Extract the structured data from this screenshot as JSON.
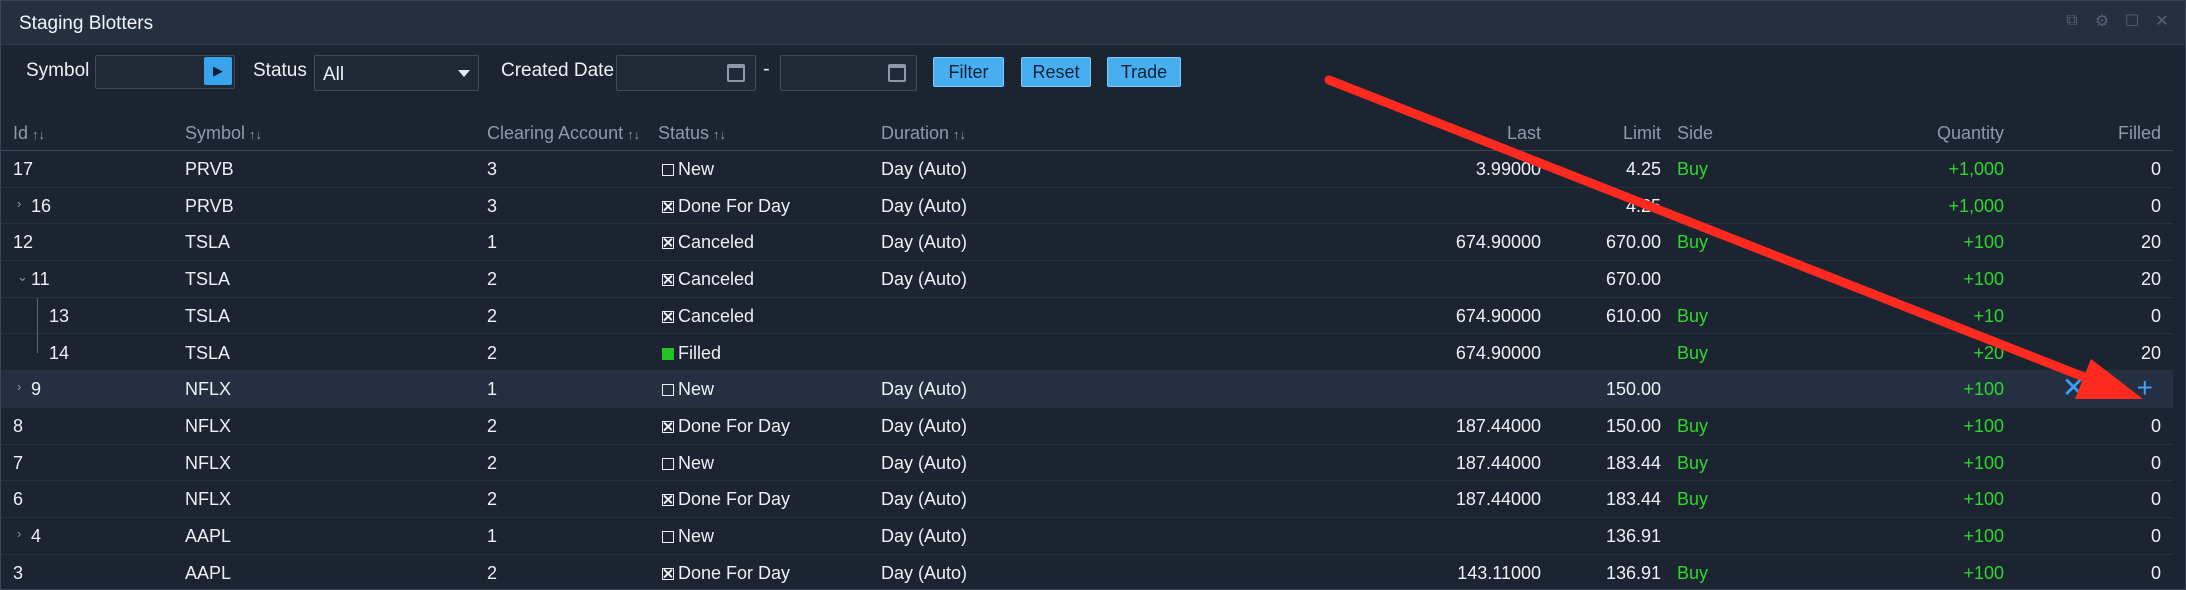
{
  "window": {
    "title": "Staging Blotters"
  },
  "toolbar": {
    "symbol_label": "Symbol",
    "symbol_value": "",
    "status_label": "Status",
    "status_value": "All",
    "created_date_label": "Created Date",
    "date_from": "",
    "date_to": "",
    "date_separator": "-",
    "filter_label": "Filter",
    "reset_label": "Reset",
    "trade_label": "Trade"
  },
  "columns": {
    "id": "Id",
    "symbol": "Symbol",
    "clearing_account": "Clearing Account",
    "status": "Status",
    "duration": "Duration",
    "last": "Last",
    "limit": "Limit",
    "side": "Side",
    "quantity": "Quantity",
    "filled": "Filled"
  },
  "rows": [
    {
      "id": "17",
      "symbol": "PRVB",
      "account": "3",
      "status": "New",
      "status_icon": "empty-square",
      "duration": "Day (Auto)",
      "last": "3.99000",
      "limit": "4.25",
      "side": "Buy",
      "quantity": "+1,000",
      "filled": "0"
    },
    {
      "id": "16",
      "symbol": "PRVB",
      "account": "3",
      "status": "Done For Day",
      "status_icon": "x-square",
      "duration": "Day (Auto)",
      "last": "",
      "limit": "4.25",
      "side": "",
      "quantity": "+1,000",
      "filled": "0"
    },
    {
      "id": "12",
      "symbol": "TSLA",
      "account": "1",
      "status": "Canceled",
      "status_icon": "x-square",
      "duration": "Day (Auto)",
      "last": "674.90000",
      "limit": "670.00",
      "side": "Buy",
      "quantity": "+100",
      "filled": "20"
    },
    {
      "id": "11",
      "symbol": "TSLA",
      "account": "2",
      "status": "Canceled",
      "status_icon": "x-square",
      "duration": "Day (Auto)",
      "last": "",
      "limit": "670.00",
      "side": "",
      "quantity": "+100",
      "filled": "20"
    },
    {
      "id": "13",
      "symbol": "TSLA",
      "account": "2",
      "status": "Canceled",
      "status_icon": "x-square",
      "duration": "",
      "last": "674.90000",
      "limit": "610.00",
      "side": "Buy",
      "quantity": "+10",
      "filled": "0"
    },
    {
      "id": "14",
      "symbol": "TSLA",
      "account": "2",
      "status": "Filled",
      "status_icon": "filled-square",
      "duration": "",
      "last": "674.90000",
      "limit": "",
      "side": "Buy",
      "quantity": "+20",
      "filled": "20"
    },
    {
      "id": "9",
      "symbol": "NFLX",
      "account": "1",
      "status": "New",
      "status_icon": "empty-square",
      "duration": "Day (Auto)",
      "last": "",
      "limit": "150.00",
      "side": "",
      "quantity": "+100",
      "filled": ""
    },
    {
      "id": "8",
      "symbol": "NFLX",
      "account": "2",
      "status": "Done For Day",
      "status_icon": "x-square",
      "duration": "Day (Auto)",
      "last": "187.44000",
      "limit": "150.00",
      "side": "Buy",
      "quantity": "+100",
      "filled": "0"
    },
    {
      "id": "7",
      "symbol": "NFLX",
      "account": "2",
      "status": "New",
      "status_icon": "empty-square",
      "duration": "Day (Auto)",
      "last": "187.44000",
      "limit": "183.44",
      "side": "Buy",
      "quantity": "+100",
      "filled": "0"
    },
    {
      "id": "6",
      "symbol": "NFLX",
      "account": "2",
      "status": "Done For Day",
      "status_icon": "x-square",
      "duration": "Day (Auto)",
      "last": "187.44000",
      "limit": "183.44",
      "side": "Buy",
      "quantity": "+100",
      "filled": "0"
    },
    {
      "id": "4",
      "symbol": "AAPL",
      "account": "1",
      "status": "New",
      "status_icon": "empty-square",
      "duration": "Day (Auto)",
      "last": "",
      "limit": "136.91",
      "side": "",
      "quantity": "+100",
      "filled": "0"
    },
    {
      "id": "3",
      "symbol": "AAPL",
      "account": "2",
      "status": "Done For Day",
      "status_icon": "x-square",
      "duration": "Day (Auto)",
      "last": "143.11000",
      "limit": "136.91",
      "side": "Buy",
      "quantity": "+100",
      "filled": "0"
    }
  ],
  "row_actions": [
    "close-icon",
    "refresh-icon",
    "plus-icon"
  ],
  "colors": {
    "accent": "#38a4ee",
    "buy": "#2ed62e",
    "annotation_arrow": "#ff2a1f"
  }
}
